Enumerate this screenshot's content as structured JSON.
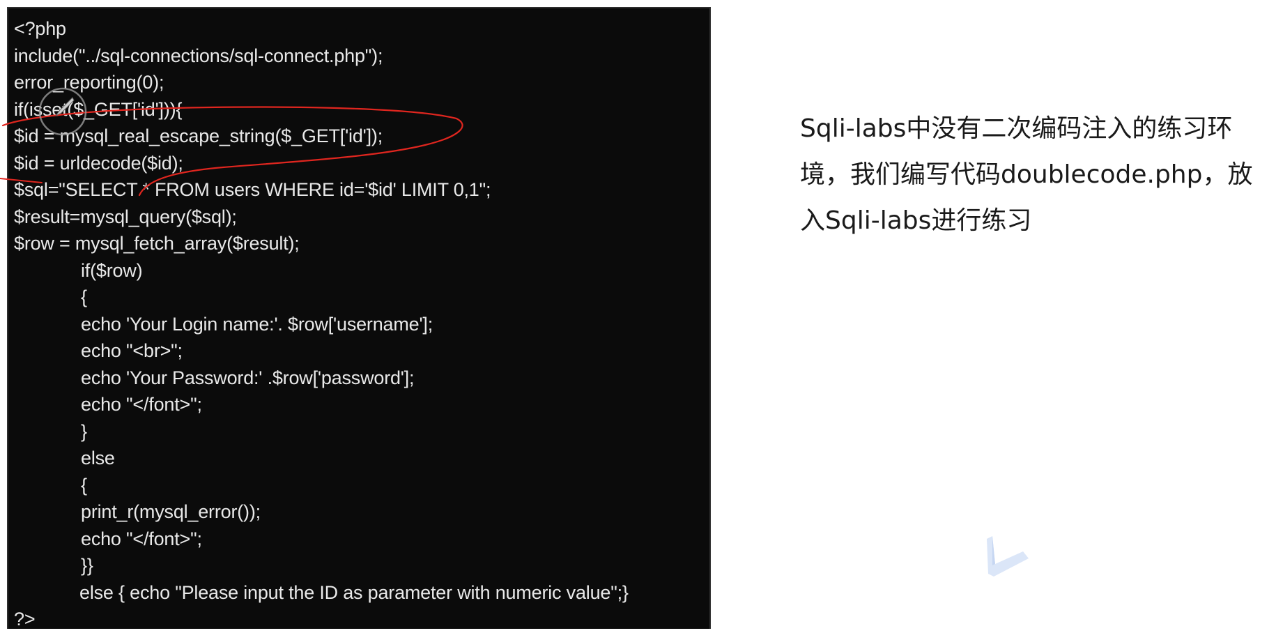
{
  "code": {
    "lines": [
      "<?php",
      "include(\"../sql-connections/sql-connect.php\");",
      "error_reporting(0);",
      "if(isset($_GET['id'])){",
      "$id = mysql_real_escape_string($_GET['id']);",
      "$id = urldecode($id);",
      "$sql=\"SELECT * FROM users WHERE id='$id' LIMIT 0,1\";",
      "$result=mysql_query($sql);",
      "$row = mysql_fetch_array($result);",
      "if($row)",
      "{",
      "echo 'Your Login name:'. $row['username'];",
      "echo \"<br>\";",
      "echo 'Your Password:' .$row['password'];",
      "echo \"</font>\";",
      "}",
      "else",
      "{",
      "print_r(mysql_error());",
      "echo \"</font>\";",
      "}}",
      "else { echo \"Please input the ID as parameter with numeric value\";}",
      "?>"
    ]
  },
  "description": {
    "line1": "Sqli-labs中没有二次编码注入的练习环",
    "line2": "境，我们编写代码doublecode.php，放",
    "line3": "入Sqli-labs进行练习"
  },
  "colors": {
    "code_background": "#0b0b0b",
    "code_text": "#e9e9e9",
    "annotation": "#e0261f",
    "logo": "#dbe6f8"
  },
  "icons": {
    "logo": "bilibili-style-watermark-icon",
    "cursor": "pen-cursor-icon"
  }
}
